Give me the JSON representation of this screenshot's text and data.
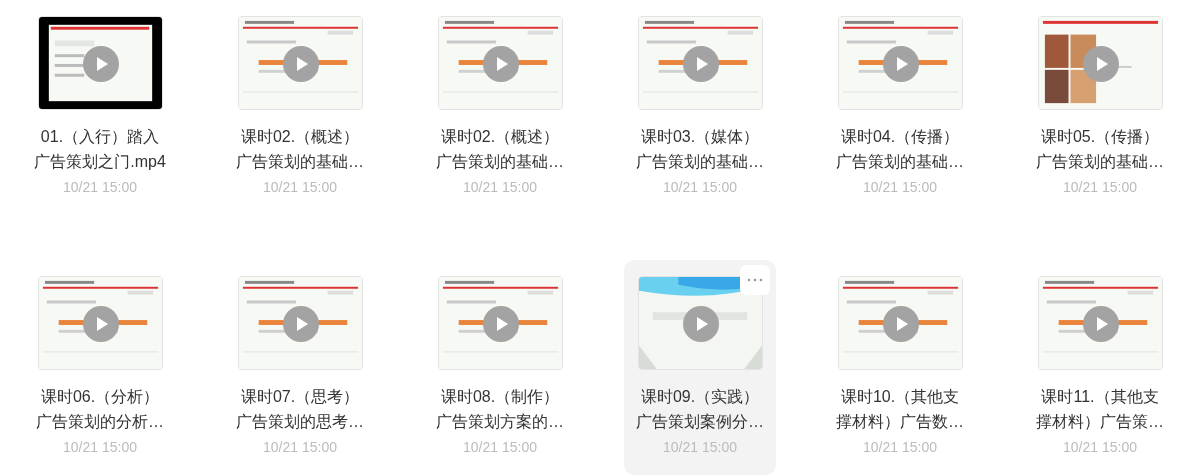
{
  "files": [
    {
      "kind": "video",
      "title_lines": [
        "01.（入行）踏入",
        "广告策划之门.mp4"
      ],
      "date": "10/21 15:00",
      "selected": false
    },
    {
      "kind": "slide",
      "title_lines": [
        "课时02.（概述）",
        "广告策划的基础…"
      ],
      "date": "10/21 15:00",
      "selected": false
    },
    {
      "kind": "slide",
      "title_lines": [
        "课时02.（概述）",
        "广告策划的基础…"
      ],
      "date": "10/21 15:00",
      "selected": false
    },
    {
      "kind": "slide",
      "title_lines": [
        "课时03.（媒体）",
        "广告策划的基础…"
      ],
      "date": "10/21 15:00",
      "selected": false
    },
    {
      "kind": "slide",
      "title_lines": [
        "课时04.（传播）",
        "广告策划的基础…"
      ],
      "date": "10/21 15:00",
      "selected": false
    },
    {
      "title_lines": [
        "课时05.（传播）",
        "广告策划的基础…"
      ],
      "date": "10/21 15:00",
      "selected": false
    },
    {
      "kind": "slide",
      "title_lines": [
        "课时06.（分析）",
        "广告策划的分析…"
      ],
      "date": "10/21 15:00",
      "selected": false
    },
    {
      "kind": "slide",
      "title_lines": [
        "课时07.（思考）",
        "广告策划的思考…"
      ],
      "date": "10/21 15:00",
      "selected": false
    },
    {
      "kind": "slide",
      "title_lines": [
        "课时08.（制作）",
        "广告策划方案的…"
      ],
      "date": "10/21 15:00",
      "selected": false
    },
    {
      "kind": "cover",
      "title_lines": [
        "课时09.（实践）",
        "广告策划案例分…"
      ],
      "date": "10/21 15:00",
      "selected": true
    },
    {
      "kind": "slide",
      "title_lines": [
        "课时10.（其他支",
        "撑材料）广告数…"
      ],
      "date": "10/21 15:00",
      "selected": false
    },
    {
      "kind": "slide",
      "title_lines": [
        "课时11.（其他支",
        "撑材料）广告策…"
      ],
      "date": "10/21 15:00",
      "selected": false
    }
  ]
}
